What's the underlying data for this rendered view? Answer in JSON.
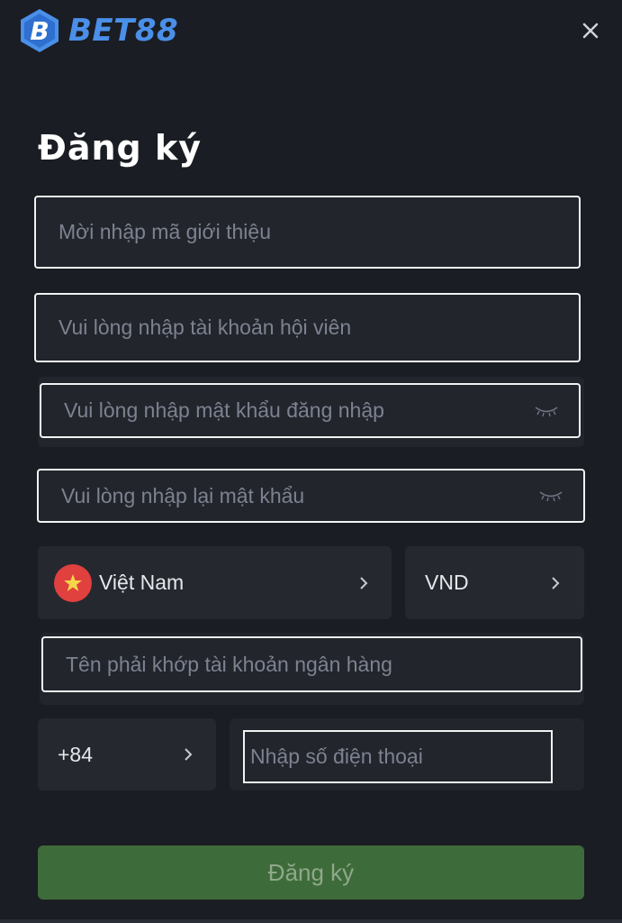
{
  "brand": {
    "name": "BET88",
    "accent": "#4a8fe8"
  },
  "header": {
    "close_icon": "close-icon"
  },
  "form": {
    "title": "Đăng ký",
    "referral": {
      "placeholder": "Mời nhập mã giới thiệu",
      "value": ""
    },
    "account": {
      "placeholder": "Vui lòng nhập tài khoản hội viên",
      "value": ""
    },
    "password": {
      "placeholder": "Vui lòng nhập mật khẩu đăng nhập",
      "value": "",
      "icon": "eye-closed-icon"
    },
    "confirm_password": {
      "placeholder": "Vui lòng nhập lại mật khẩu",
      "value": "",
      "icon": "eye-closed-icon"
    },
    "country": {
      "label": "Việt Nam",
      "icon": "vietnam-flag-icon"
    },
    "currency": {
      "label": "VND"
    },
    "bank_name": {
      "placeholder": "Tên phải khớp tài khoản ngân hàng",
      "value": ""
    },
    "phone_code": {
      "label": "+84"
    },
    "phone": {
      "placeholder": "Nhập số điện thoại",
      "value": ""
    },
    "submit_label": "Đăng ký",
    "submit_color": "#3e6b3a"
  }
}
